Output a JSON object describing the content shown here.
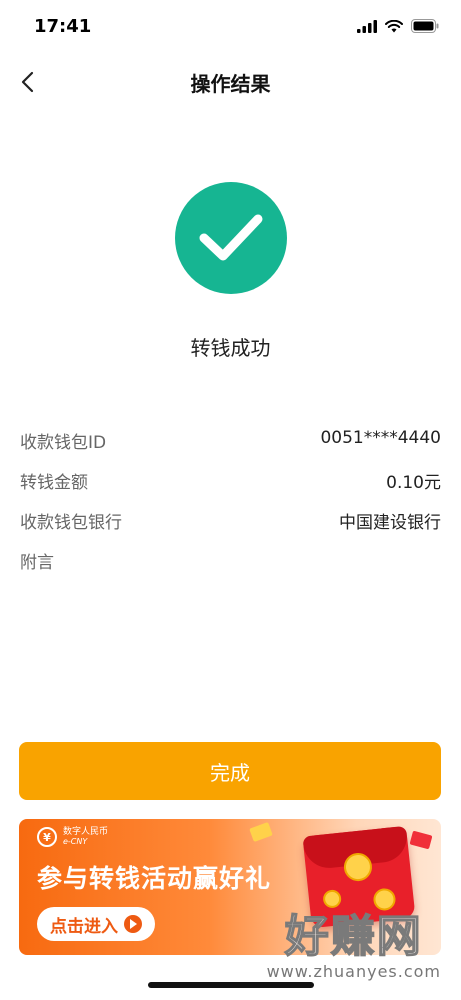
{
  "status_bar": {
    "time": "17:41"
  },
  "nav": {
    "title": "操作结果"
  },
  "result": {
    "text": "转钱成功"
  },
  "details": [
    {
      "label": "收款钱包ID",
      "value": "0051****4440"
    },
    {
      "label": "转钱金额",
      "value": "0.10元"
    },
    {
      "label": "收款钱包银行",
      "value": "中国建设银行"
    },
    {
      "label": "附言",
      "value": ""
    }
  ],
  "done_button": {
    "label": "完成"
  },
  "banner": {
    "logo_cn": "数字人民币",
    "logo_en": "e-CNY",
    "logo_symbol": "¥",
    "headline": "参与转钱活动赢好礼",
    "cta": "点击进入"
  },
  "watermark": {
    "big": "好赚网",
    "small": "www.zhuanyes.com"
  },
  "colors": {
    "success": "#16b592",
    "primary": "#f9a300",
    "banner_orange": "#f76a10"
  }
}
